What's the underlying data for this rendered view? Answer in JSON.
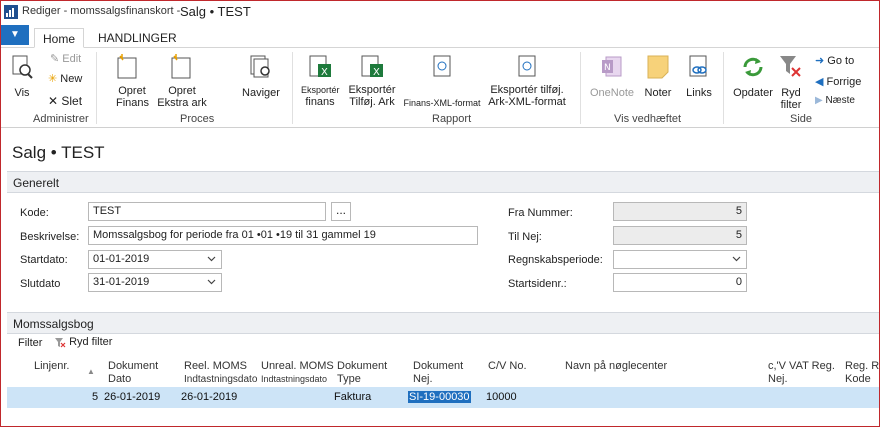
{
  "window": {
    "title": "Rediger - momssalgsfinanskort -",
    "subtitle": "Salg • TEST"
  },
  "ribbon": {
    "tabs": [
      {
        "label": "Home"
      },
      {
        "label": "HANDLINGER"
      }
    ],
    "groups": {
      "administrer": {
        "label": "Administrer",
        "vis": "Vis",
        "edit": "Edit",
        "new": "New",
        "slet": "Slet"
      },
      "proces": {
        "label": "Proces",
        "opret_finans_1": "Opret",
        "opret_finans_2": "Finans",
        "opret_ekstra_1": "Opret",
        "opret_ekstra_2": "Ekstra ark",
        "naviger": "Naviger"
      },
      "rapport": {
        "label": "Rapport",
        "eksporter_finans_1": "Eksportér",
        "eksporter_finans_2": "finans",
        "eksporter_tilfoj_1": "Eksportér",
        "eksporter_tilfoj_2": "Tilføj. Ark",
        "finans_xml": "Finans-XML-format",
        "eksporter_xml_1": "Eksportér tilføj.",
        "eksporter_xml_2": "Ark-XML-format"
      },
      "vis_vedhaeftet": {
        "label": "Vis vedhæftet",
        "onenote": "OneNote",
        "noter": "Noter",
        "links": "Links"
      },
      "side": {
        "label": "Side",
        "opdater": "Opdater",
        "ryd_filter_1": "Ryd",
        "ryd_filter_2": "filter",
        "goto": "Go to",
        "forrige": "Forrige",
        "naeste": "Næste"
      }
    }
  },
  "page": {
    "title": "Salg • TEST",
    "general": {
      "section_label": "Generelt",
      "kode_label": "Kode:",
      "kode_value": "TEST",
      "ellipsis": "...",
      "beskrivelse_label": "Beskrivelse:",
      "beskrivelse_value": "Momssalgsbog for periode fra 01 •01 •19 til 31 gammel 19",
      "startdato_label": "Startdato:",
      "startdato_value": "01-01-2019",
      "slutdato_label": "Slutdato",
      "slutdato_value": "31-01-2019",
      "fra_nummer_label": "Fra Nummer:",
      "fra_nummer_value": "5",
      "til_nej_label": "Til Nej:",
      "til_nej_value": "5",
      "regnskabsperiode_label": "Regnskabsperiode:",
      "regnskabsperiode_value": "",
      "startsidenr_label": "Startsidenr.:",
      "startsidenr_value": "0"
    },
    "momssalgsbog": {
      "section_label": "Momssalgsbog",
      "filter_label": "Filter",
      "ryd_filter_label": "Ryd filter",
      "columns": {
        "linjenr": "Linjenr.",
        "dok_dato_1": "Dokument",
        "dok_dato_2": "Dato",
        "reel_1": "Reel. MOMS",
        "reel_2": "Indtastningsdato",
        "unreal_1": "Unreal. MOMS",
        "unreal_2": "Indtastningsdato",
        "dok_type_1": "Dokument",
        "dok_type_2": "Type",
        "dok_nej_1": "Dokument",
        "dok_nej_2": "Nej.",
        "cv_no": "C/V No.",
        "navn": "Navn på nøglecenter",
        "vat_reg_1": "c,'V VAT Reg.",
        "vat_reg_2": "Nej.",
        "reg_kode_1": "Reg. Re",
        "reg_kode_2": "Kode"
      },
      "rows": [
        {
          "linjenr": "5",
          "dok_dato": "26-01-2019",
          "reel_dato": "26-01-2019",
          "unreal_dato": "",
          "dok_type": "Faktura",
          "dok_nej": "SI-19-00030",
          "cv_no": "10000",
          "navn": "",
          "vat_reg": "",
          "reg_kode": ""
        }
      ]
    }
  },
  "colors": {
    "accent": "#1f6fbf",
    "section_bg": "#eef0f3",
    "selected_row": "#cde4f7",
    "frame": "#c0282c"
  }
}
